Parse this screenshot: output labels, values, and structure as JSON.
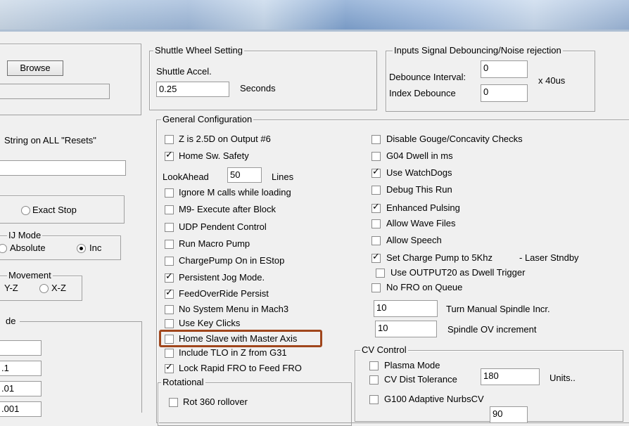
{
  "left": {
    "browse_label": "Browse",
    "string_label": "String on ALL  \"Resets\"",
    "exact_stop_label": "Exact Stop",
    "ij_mode": {
      "title": "IJ Mode",
      "absolute": "Absolute",
      "inc": "Inc"
    },
    "movement": {
      "title": "Movement",
      "yz": "Y-Z",
      "xz": "X-Z"
    },
    "mode_title": "de",
    "values": [
      ".1",
      ".01",
      ".001"
    ]
  },
  "shuttle": {
    "title": "Shuttle Wheel Setting",
    "accel_label": "Shuttle Accel.",
    "accel_value": "0.25",
    "seconds": "Seconds"
  },
  "inputs": {
    "title": "Inputs Signal Debouncing/Noise rejection",
    "debounce_label": "Debounce Interval:",
    "debounce_value": "0",
    "index_label": "Index Debounce",
    "index_value": "0",
    "unit": "x 40us"
  },
  "general": {
    "title": "General Configuration",
    "z25d": "Z is 2.5D on Output #6",
    "home_safety": "Home Sw. Safety",
    "lookahead_label": "LookAhead",
    "lookahead_value": "50",
    "lines": "Lines",
    "ignore_m": "Ignore M calls while loading",
    "m9": "M9- Execute after Block",
    "udp": "UDP Pendent Control",
    "macro_pump": "Run Macro Pump",
    "chargepump": "ChargePump On in EStop",
    "persistent_jog": "Persistent Jog Mode.",
    "feedoverride": "FeedOverRide Persist",
    "no_sys_menu": "No System Menu in Mach3",
    "key_clicks": "Use Key Clicks",
    "home_slave": "Home Slave with Master Axis",
    "include_tlo": "Include TLO in Z from G31",
    "lock_rapid": "Lock Rapid FRO to Feed FRO",
    "disable_gouge": "Disable Gouge/Concavity Checks",
    "g04": "G04 Dwell in ms",
    "watchdogs": "Use WatchDogs",
    "debug": "Debug This Run",
    "enhanced": "Enhanced Pulsing",
    "wave": "Allow Wave Files",
    "speech": "Allow Speech",
    "charge5k": "Set Charge Pump to 5Khz",
    "laser": "- Laser Stndby",
    "output20": "Use OUTPUT20 as Dwell Trigger",
    "no_fro": "No FRO on Queue",
    "spindle_incr_value": "10",
    "spindle_incr_label": "Turn Manual Spindle Incr.",
    "spindle_ov_value": "10",
    "spindle_ov_label": "Spindle OV increment"
  },
  "rotational": {
    "title": "Rotational",
    "rot360": "Rot 360 rollover"
  },
  "cv": {
    "title": "CV Control",
    "plasma": "Plasma Mode",
    "dist_label": "CV Dist Tolerance",
    "dist_value": "180",
    "units": "Units..",
    "g100": "G100 Adaptive NurbsCV",
    "stop_value": "90"
  }
}
